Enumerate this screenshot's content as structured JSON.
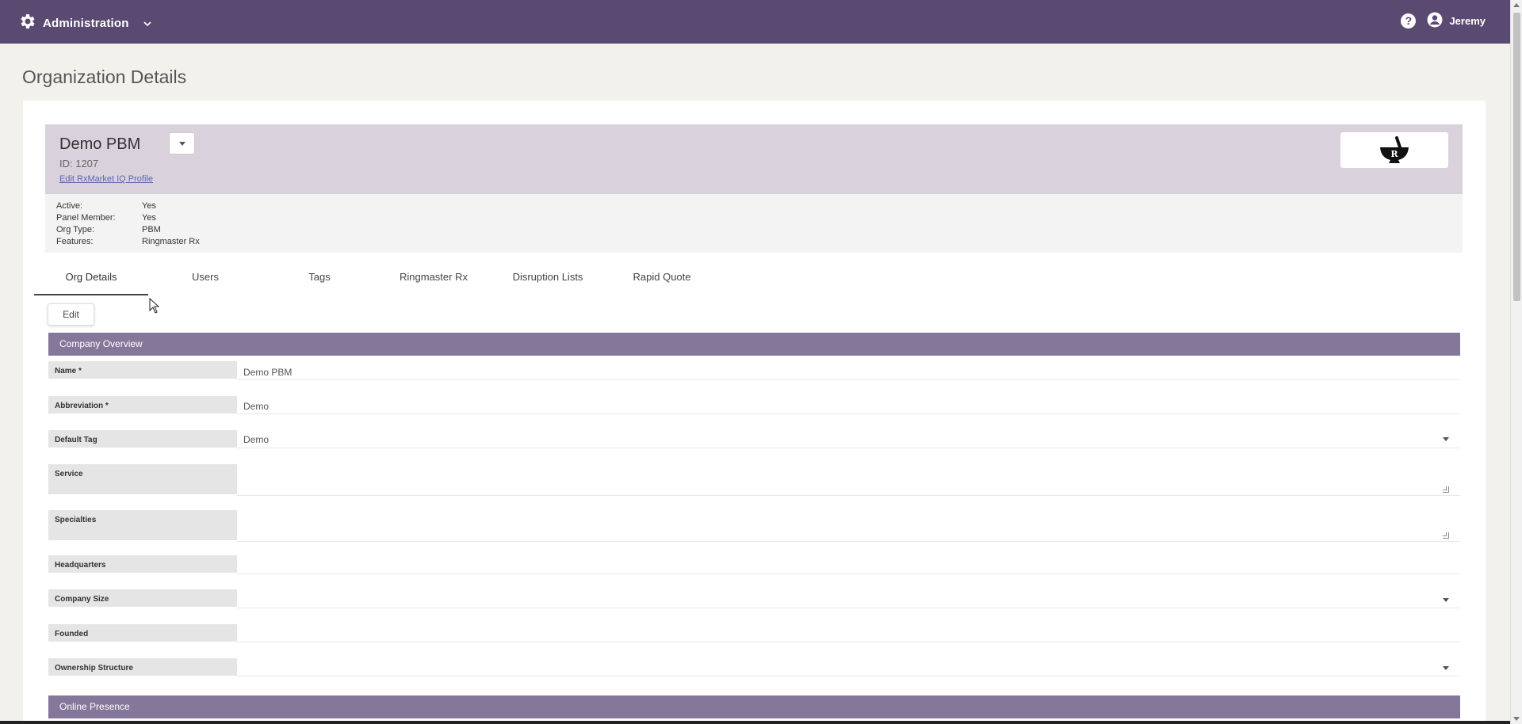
{
  "topbar": {
    "app_label": "Administration",
    "help_symbol": "?",
    "user_name": "Jeremy",
    "bg_color": "#5a4a72"
  },
  "page": {
    "title": "Organization Details"
  },
  "org": {
    "name": "Demo PBM",
    "id_text": "ID: 1207",
    "edit_link": "Edit RxMarket IQ Profile",
    "logo_text": "R",
    "meta": [
      {
        "key": "Active:",
        "value": "Yes"
      },
      {
        "key": "Panel Member:",
        "value": "Yes"
      },
      {
        "key": "Org Type:",
        "value": "PBM"
      },
      {
        "key": "Features:",
        "value": "Ringmaster Rx"
      }
    ]
  },
  "tabs": [
    "Org Details",
    "Users",
    "Tags",
    "Ringmaster Rx",
    "Disruption Lists",
    "Rapid Quote"
  ],
  "edit_label": "Edit",
  "sections": {
    "company_overview": "Company Overview",
    "online_presence": "Online Presence"
  },
  "fields": [
    {
      "label": "Name *",
      "value": "Demo PBM",
      "kind": "text"
    },
    {
      "label": "Abbreviation *",
      "value": "Demo",
      "kind": "text"
    },
    {
      "label": "Default Tag",
      "value": "Demo",
      "kind": "select"
    },
    {
      "label": "Service",
      "value": "",
      "kind": "textarea"
    },
    {
      "label": "Specialties",
      "value": "",
      "kind": "textarea"
    },
    {
      "label": "Headquarters",
      "value": "",
      "kind": "text"
    },
    {
      "label": "Company Size",
      "value": "",
      "kind": "select"
    },
    {
      "label": "Founded",
      "value": "",
      "kind": "text"
    },
    {
      "label": "Ownership Structure",
      "value": "",
      "kind": "select"
    }
  ]
}
